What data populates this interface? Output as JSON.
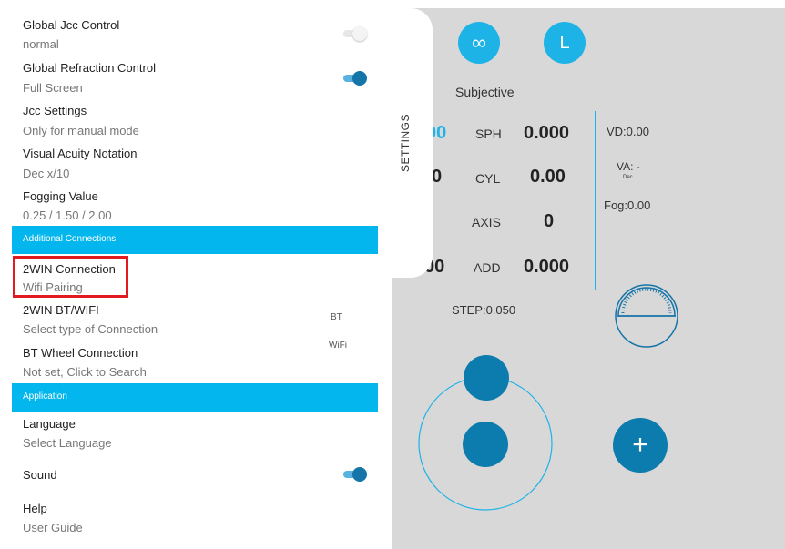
{
  "settings": {
    "tab_label": "SETTINGS",
    "items": [
      {
        "title": "Global Jcc Control",
        "subtitle": "normal",
        "toggle": "off"
      },
      {
        "title": "Global Refraction Control",
        "subtitle": "Full Screen",
        "toggle": "on"
      },
      {
        "title": "Jcc Settings",
        "subtitle": "Only for manual mode"
      },
      {
        "title": "Visual Acuity Notation",
        "subtitle": "Dec x/10"
      },
      {
        "title": "Fogging Value",
        "subtitle": "0.25 / 1.50 / 2.00"
      }
    ],
    "section_additional": "Additional Connections",
    "connections": [
      {
        "title": "2WIN Connection",
        "subtitle": "Wifi Pairing"
      },
      {
        "title": "2WIN BT/WIFI",
        "subtitle": "Select type of Connection"
      },
      {
        "title": "BT Wheel Connection",
        "subtitle": "Not set, Click to Search"
      }
    ],
    "conn_options": {
      "bt": "BT",
      "wifi": "WiFi"
    },
    "section_application": "Application",
    "application": {
      "language_title": "Language",
      "language_sub": "Select Language",
      "sound_title": "Sound",
      "sound_toggle": "on",
      "help_title": "Help",
      "help_sub": "User Guide"
    }
  },
  "refraction": {
    "binocular_icon": "infinity-icon",
    "binocular_label": "∞",
    "eye_button": "L",
    "mode": "Subjective",
    "left_partial": [
      "00",
      "0",
      "00"
    ],
    "labels": {
      "sph": "SPH",
      "cyl": "CYL",
      "axis": "AXIS",
      "add": "ADD"
    },
    "values": {
      "sph": "0.000",
      "cyl": "0.00",
      "axis": "0",
      "add": "0.000"
    },
    "vd": "VD:0.00",
    "va": "VA: -",
    "va_notation": "Dec",
    "fog": "Fog:0.00",
    "step": "STEP:0.050",
    "plus_label": "+"
  },
  "colors": {
    "accent": "#1eb3e6",
    "dark_accent": "#0c7bad",
    "section": "#03b7ee",
    "highlight": "#e21b23"
  }
}
